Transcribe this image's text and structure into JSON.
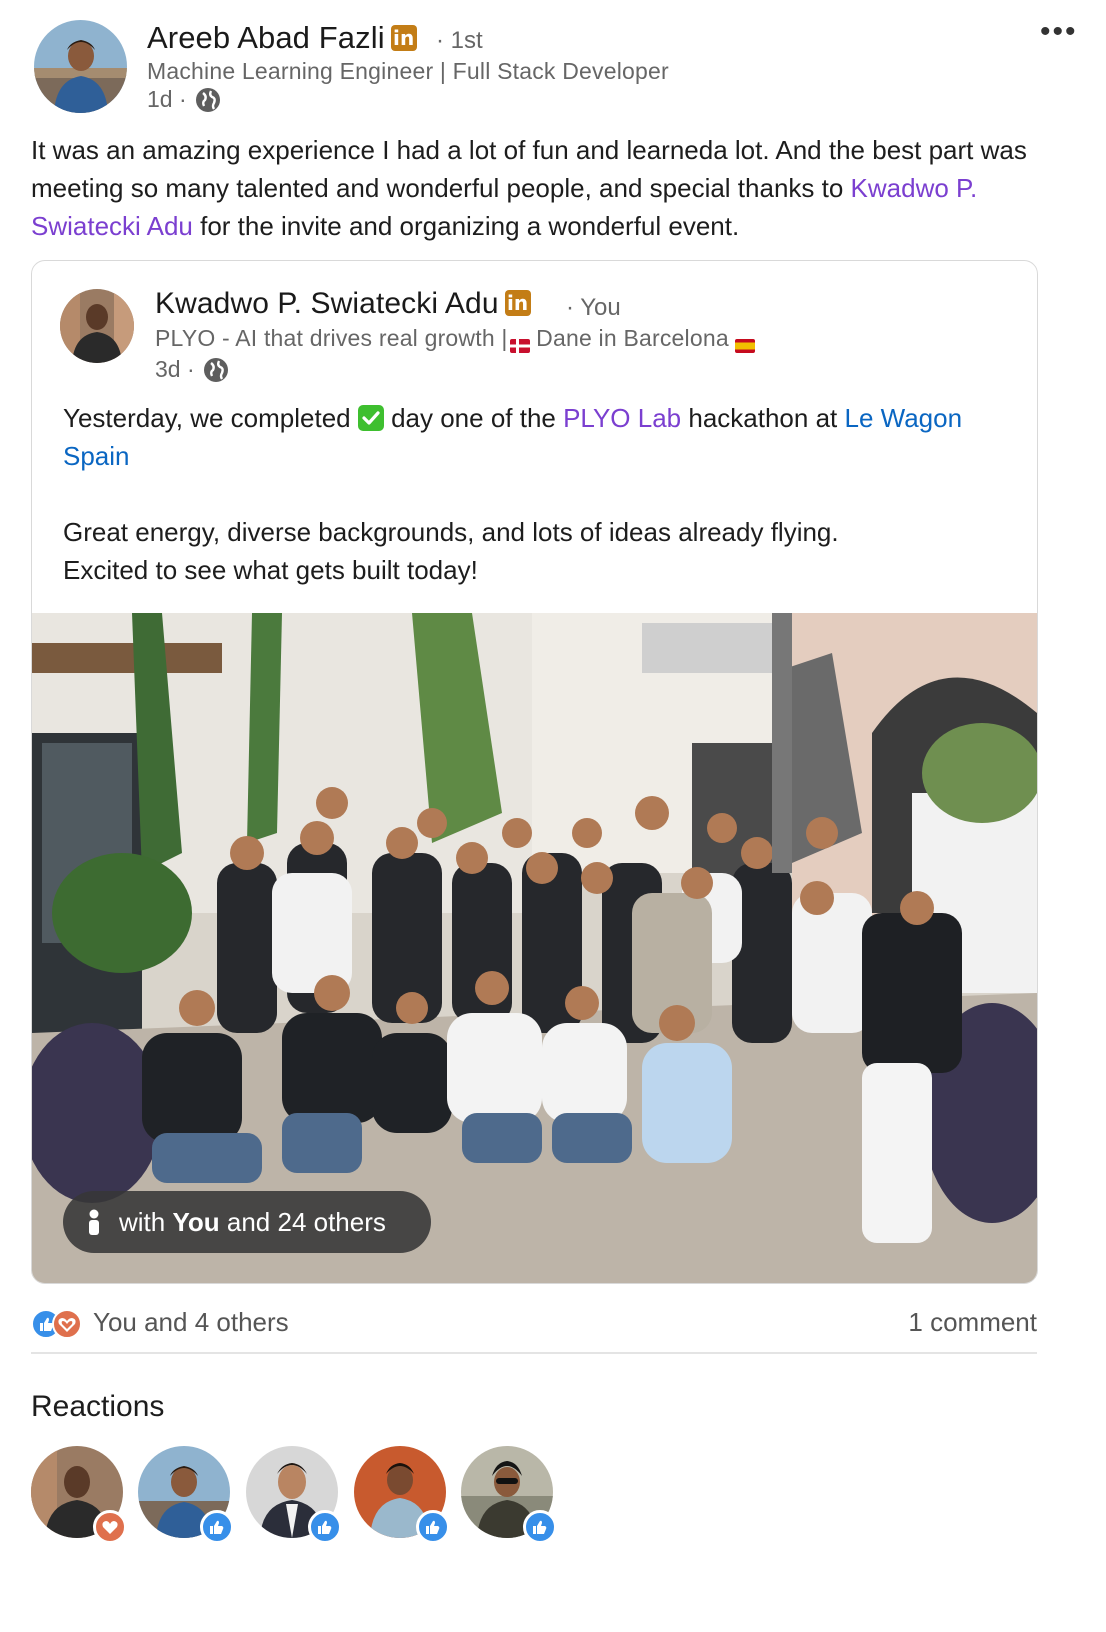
{
  "author": {
    "name": "Areeb Abad Fazli",
    "linkedin_badge": "in",
    "degree": "· 1st",
    "headline": "Machine Learning Engineer | Full Stack Developer",
    "time": "1d ·",
    "visibility_icon": "globe-icon"
  },
  "post": {
    "text_part1": "It was an amazing experience I had a lot of fun and learneda lot. And the best part was meeting so many talented and wonderful people, and special thanks to ",
    "mention": "Kwadwo P. Swiatecki Adu",
    "text_part2": " for the invite and organizing a wonderful event."
  },
  "shared": {
    "author_name": "Kwadwo P. Swiatecki Adu",
    "linkedin_badge": "in",
    "degree": "· You",
    "headline_part1": "PLYO - AI that drives real growth | ",
    "headline_part2": " Dane in Barcelona ",
    "time": "3d ·",
    "text_1a": "Yesterday, we completed ",
    "text_1b": " day one of the ",
    "mention_plyo": "PLYO Lab",
    "text_1c": " hackathon at ",
    "link_lewagon": "Le Wagon Spain",
    "text_2": "Great energy, diverse backgrounds, and lots of ideas already flying.",
    "text_3": "Excited to see what gets built today!",
    "tag_pill_prefix": "with ",
    "tag_pill_you": "You",
    "tag_pill_suffix": " and 24 others"
  },
  "social": {
    "reactions_text": "You and 4 others",
    "comments_text": "1 comment"
  },
  "reactions_section": {
    "title": "Reactions",
    "reactors": [
      {
        "reaction": "love"
      },
      {
        "reaction": "like"
      },
      {
        "reaction": "like"
      },
      {
        "reaction": "like"
      },
      {
        "reaction": "like"
      }
    ]
  },
  "colors": {
    "mention": "#7b3fd0",
    "link": "#0a66c2",
    "linkedin_badge": "#c37d16",
    "like": "#378fe9",
    "love": "#df704d"
  }
}
